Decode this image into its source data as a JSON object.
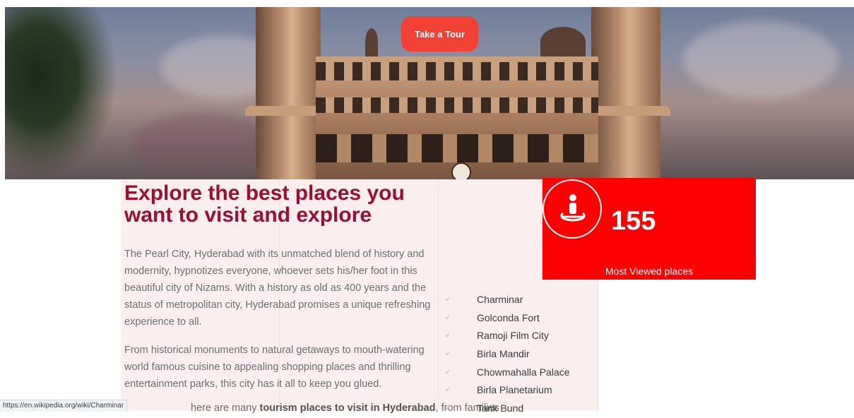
{
  "hero": {
    "tour_button": "Take a Tour"
  },
  "intro": {
    "headline": "Explore the best places you want to visit and explore",
    "paragraph1": "The Pearl City, Hyderabad with its unmatched blend of history and modernity, hypnotizes everyone, whoever sets his/her foot in this beautiful city of Nizams. With a history as old as 400 years and the status of metropolitan city, Hyderabad promises a unique refreshing experience to all.",
    "paragraph2": "From historical monuments to natural getaways to mouth-watering world famous cuisine to appealing shopping places and thrilling entertainment parks, this city has it all to keep you glued.",
    "paragraph3_prefix": "here are many ",
    "paragraph3_bold": "tourism places to visit in Hyderabad",
    "paragraph3_suffix": ", from families"
  },
  "stat": {
    "icon": "person-location-icon",
    "value": "155",
    "label": "Most Viewed places"
  },
  "places": [
    "Charminar",
    "Golconda Fort",
    "Ramoji Film City",
    "Birla Mandir",
    "Chowmahalla Palace",
    "Birla Planetarium",
    "Tank Bund"
  ],
  "status_bar": {
    "url": "https://en.wikipedia.org/wiki/Charminar"
  },
  "colors": {
    "headline": "#9b1032",
    "button": "#f24236",
    "stat_bg": "#ff0000",
    "content_bg": "#fbeeee"
  }
}
